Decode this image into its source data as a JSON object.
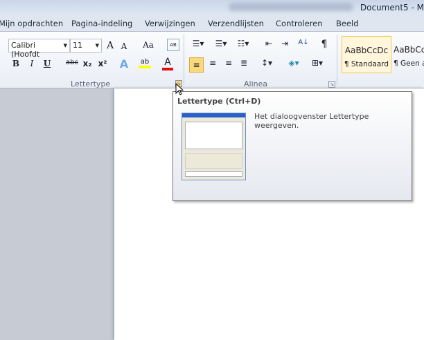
{
  "window": {
    "title": "Document5 - M"
  },
  "tabs": [
    "Mijn opdrachten",
    "Pagina-indeling",
    "Verwijzingen",
    "Verzendlijsten",
    "Controleren",
    "Beeld"
  ],
  "font_group": {
    "label": "Lettertype",
    "font_name": "Calibri (Hoofdt",
    "font_size": "11",
    "grow": "A",
    "shrink": "A",
    "change_case": "Aa",
    "bold": "B",
    "italic": "I",
    "underline": "U",
    "strike": "abc",
    "subscript": "x₂",
    "superscript": "x²",
    "text_effects": "A",
    "highlight": "ab",
    "font_color": "A"
  },
  "paragraph_group": {
    "label": "Alinea",
    "sort": "A↓",
    "pilcrow": "¶"
  },
  "styles": [
    {
      "preview": "AaBbCcDc",
      "name": "¶ Standaard"
    },
    {
      "preview": "AaBbCc",
      "name": "¶ Geen af"
    }
  ],
  "tooltip": {
    "title": "Lettertype (Ctrl+D)",
    "description": "Het dialoogvenster Lettertype weergeven."
  },
  "colors": {
    "highlight": "#ffff00",
    "font_color": "#e01010",
    "accent": "#f5c342"
  }
}
